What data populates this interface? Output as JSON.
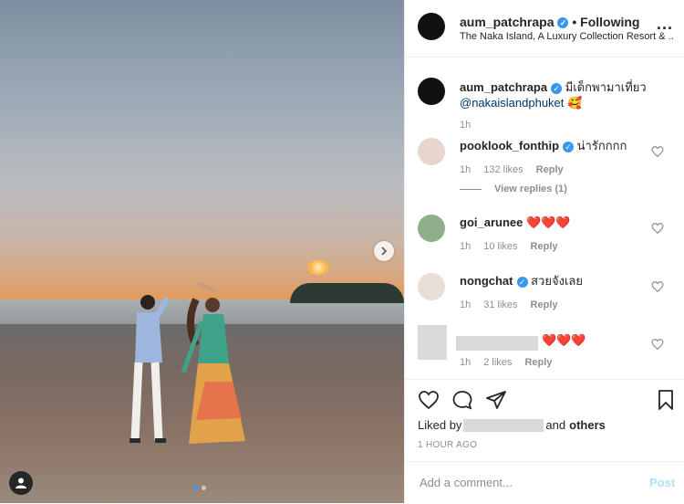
{
  "header": {
    "username": "aum_patchrapa",
    "follow_label": "• Following",
    "location": "The Naka Island, A Luxury Collection Resort & ...",
    "more_label": "..."
  },
  "caption": {
    "username": "aum_patchrapa",
    "text": "มีเด็กพามาเที่ยว",
    "mention": "@nakaislandphuket",
    "emoji": "🥰",
    "time": "1h"
  },
  "comments": [
    {
      "username": "pooklook_fonthip",
      "verified": true,
      "text": "น่ารักกกก",
      "time": "1h",
      "likes": "132 likes",
      "reply": "Reply"
    },
    {
      "username": "goi_arunee",
      "verified": false,
      "text": "❤️❤️❤️",
      "time": "1h",
      "likes": "10 likes",
      "reply": "Reply"
    },
    {
      "username": "nongchat",
      "verified": true,
      "text": "สวยจังเลย",
      "time": "1h",
      "likes": "31 likes",
      "reply": "Reply"
    },
    {
      "username": "",
      "verified": false,
      "text": "❤️❤️❤️",
      "time": "1h",
      "likes": "2 likes",
      "reply": "Reply"
    }
  ],
  "view_replies": "View replies (1)",
  "likes_summary": {
    "prefix": "Liked by",
    "suffix": "and",
    "others": "others"
  },
  "timestamp": "1 HOUR AGO",
  "add_comment": {
    "placeholder": "Add a comment...",
    "post_label": "Post"
  },
  "colors": {
    "verified": "#3897f0",
    "heart": "#ed4956",
    "link": "#00376b",
    "post_disabled": "#b2dffc"
  }
}
